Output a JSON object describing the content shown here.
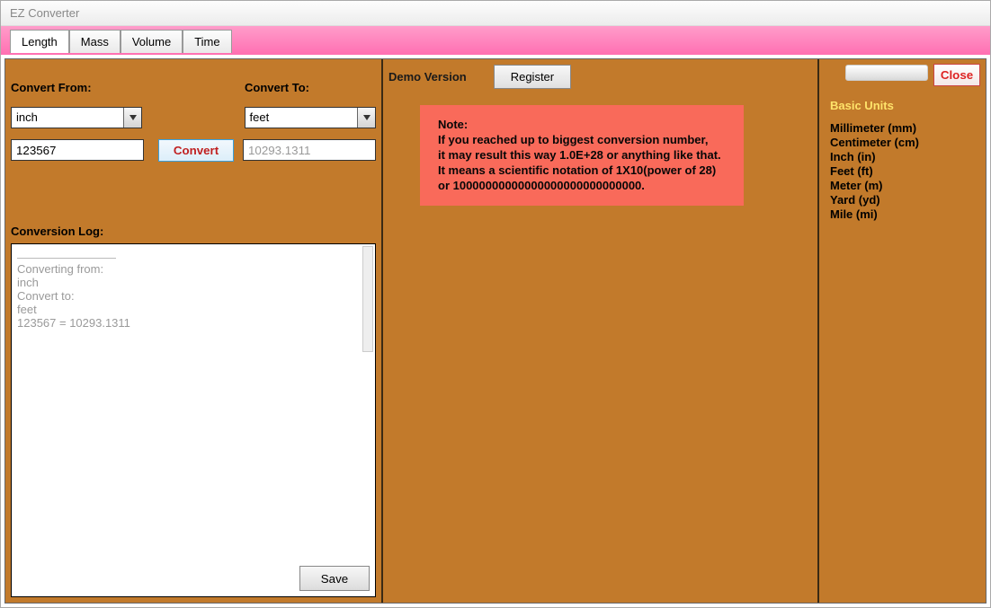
{
  "window": {
    "title": "EZ Converter"
  },
  "tabs": [
    {
      "label": "Length",
      "active": true
    },
    {
      "label": "Mass",
      "active": false
    },
    {
      "label": "Volume",
      "active": false
    },
    {
      "label": "Time",
      "active": false
    }
  ],
  "left": {
    "from_label": "Convert From:",
    "to_label": "Convert To:",
    "from_value": "inch",
    "to_value": "feet",
    "input_value": "123567",
    "result_value": "10293.1311",
    "convert_btn": "Convert",
    "log_label": "Conversion Log:",
    "log_text": "Converting from:\ninch\nConvert to:\nfeet\n123567 = 10293.1311",
    "save_btn": "Save"
  },
  "mid": {
    "demo_label": "Demo Version",
    "register_btn": "Register",
    "note_title": "Note:",
    "note_body": "If you reached up to biggest conversion number,\nit may result this way 1.0E+28 or anything like that.\nIt means a scientific notation of 1X10(power of 28)\nor 10000000000000000000000000000."
  },
  "right": {
    "close_btn": "Close",
    "units_title": "Basic Units",
    "units": [
      "Millimeter (mm)",
      "Centimeter (cm)",
      "Inch (in)",
      "Feet (ft)",
      "Meter (m)",
      "Yard (yd)",
      "Mile (mi)"
    ]
  }
}
